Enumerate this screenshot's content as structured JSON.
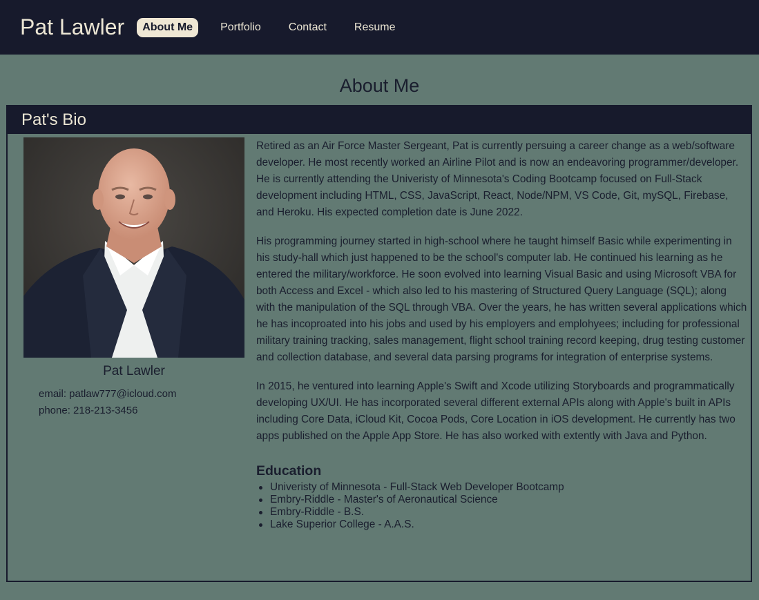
{
  "nav": {
    "brand": "Pat Lawler",
    "links": [
      "About Me",
      "Portfolio",
      "Contact",
      "Resume"
    ],
    "active_index": 0
  },
  "page": {
    "title": "About Me"
  },
  "card": {
    "header": "Pat's Bio",
    "profile": {
      "name": "Pat Lawler",
      "email_line": "email: patlaw777@icloud.com",
      "phone_line": "phone: 218-213-3456"
    },
    "bio": [
      "Retired as an Air Force Master Sergeant, Pat is currently persuing a career change as a web/software developer. He most recently worked an Airline Pilot and is now an endeavoring programmer/developer. He is currently attending the Univeristy of Minnesota's Coding Bootcamp focused on Full-Stack development including HTML, CSS, JavaScript, React, Node/NPM, VS Code, Git, mySQL, Firebase, and Heroku. His expected completion date is June 2022.",
      "His programming journey started in high-school where he taught himself Basic while experimenting in his study-hall which just happened to be the school's computer lab. He continued his learning as he entered the military/workforce. He soon evolved into learning Visual Basic and using Microsoft VBA for both Access and Excel - which also led to his mastering of Structured Query Language (SQL); along with the manipulation of the SQL through VBA. Over the years, he has written several applications which he has incoproated into his jobs and used by his employers and emplohyees; including for professional military training tracking, sales management, flight school training record keeping, drug testing customer and collection database, and several data parsing programs for integration of enterprise systems.",
      "In 2015, he ventured into learning Apple's Swift and Xcode utilizing Storyboards and programmatically developing UX/UI. He has incorporated several different external APIs along with Apple's built in APIs including Core Data, iCloud Kit, Cocoa Pods, Core Location in iOS development. He currently has two apps published on the Apple App Store. He has also worked with extently with Java and Python."
    ],
    "education": {
      "title": "Education",
      "items": [
        "Univeristy of Minnesota - Full-Stack Web Developer Bootcamp",
        "Embry-Riddle - Master's of Aeronautical Science",
        "Embry-Riddle - B.S.",
        "Lake Superior College - A.A.S."
      ]
    }
  },
  "colors": {
    "nav_bg": "#171a2c",
    "page_bg": "#627a73",
    "nav_text": "#ece6d4",
    "active_pill": "#efe7d4"
  }
}
